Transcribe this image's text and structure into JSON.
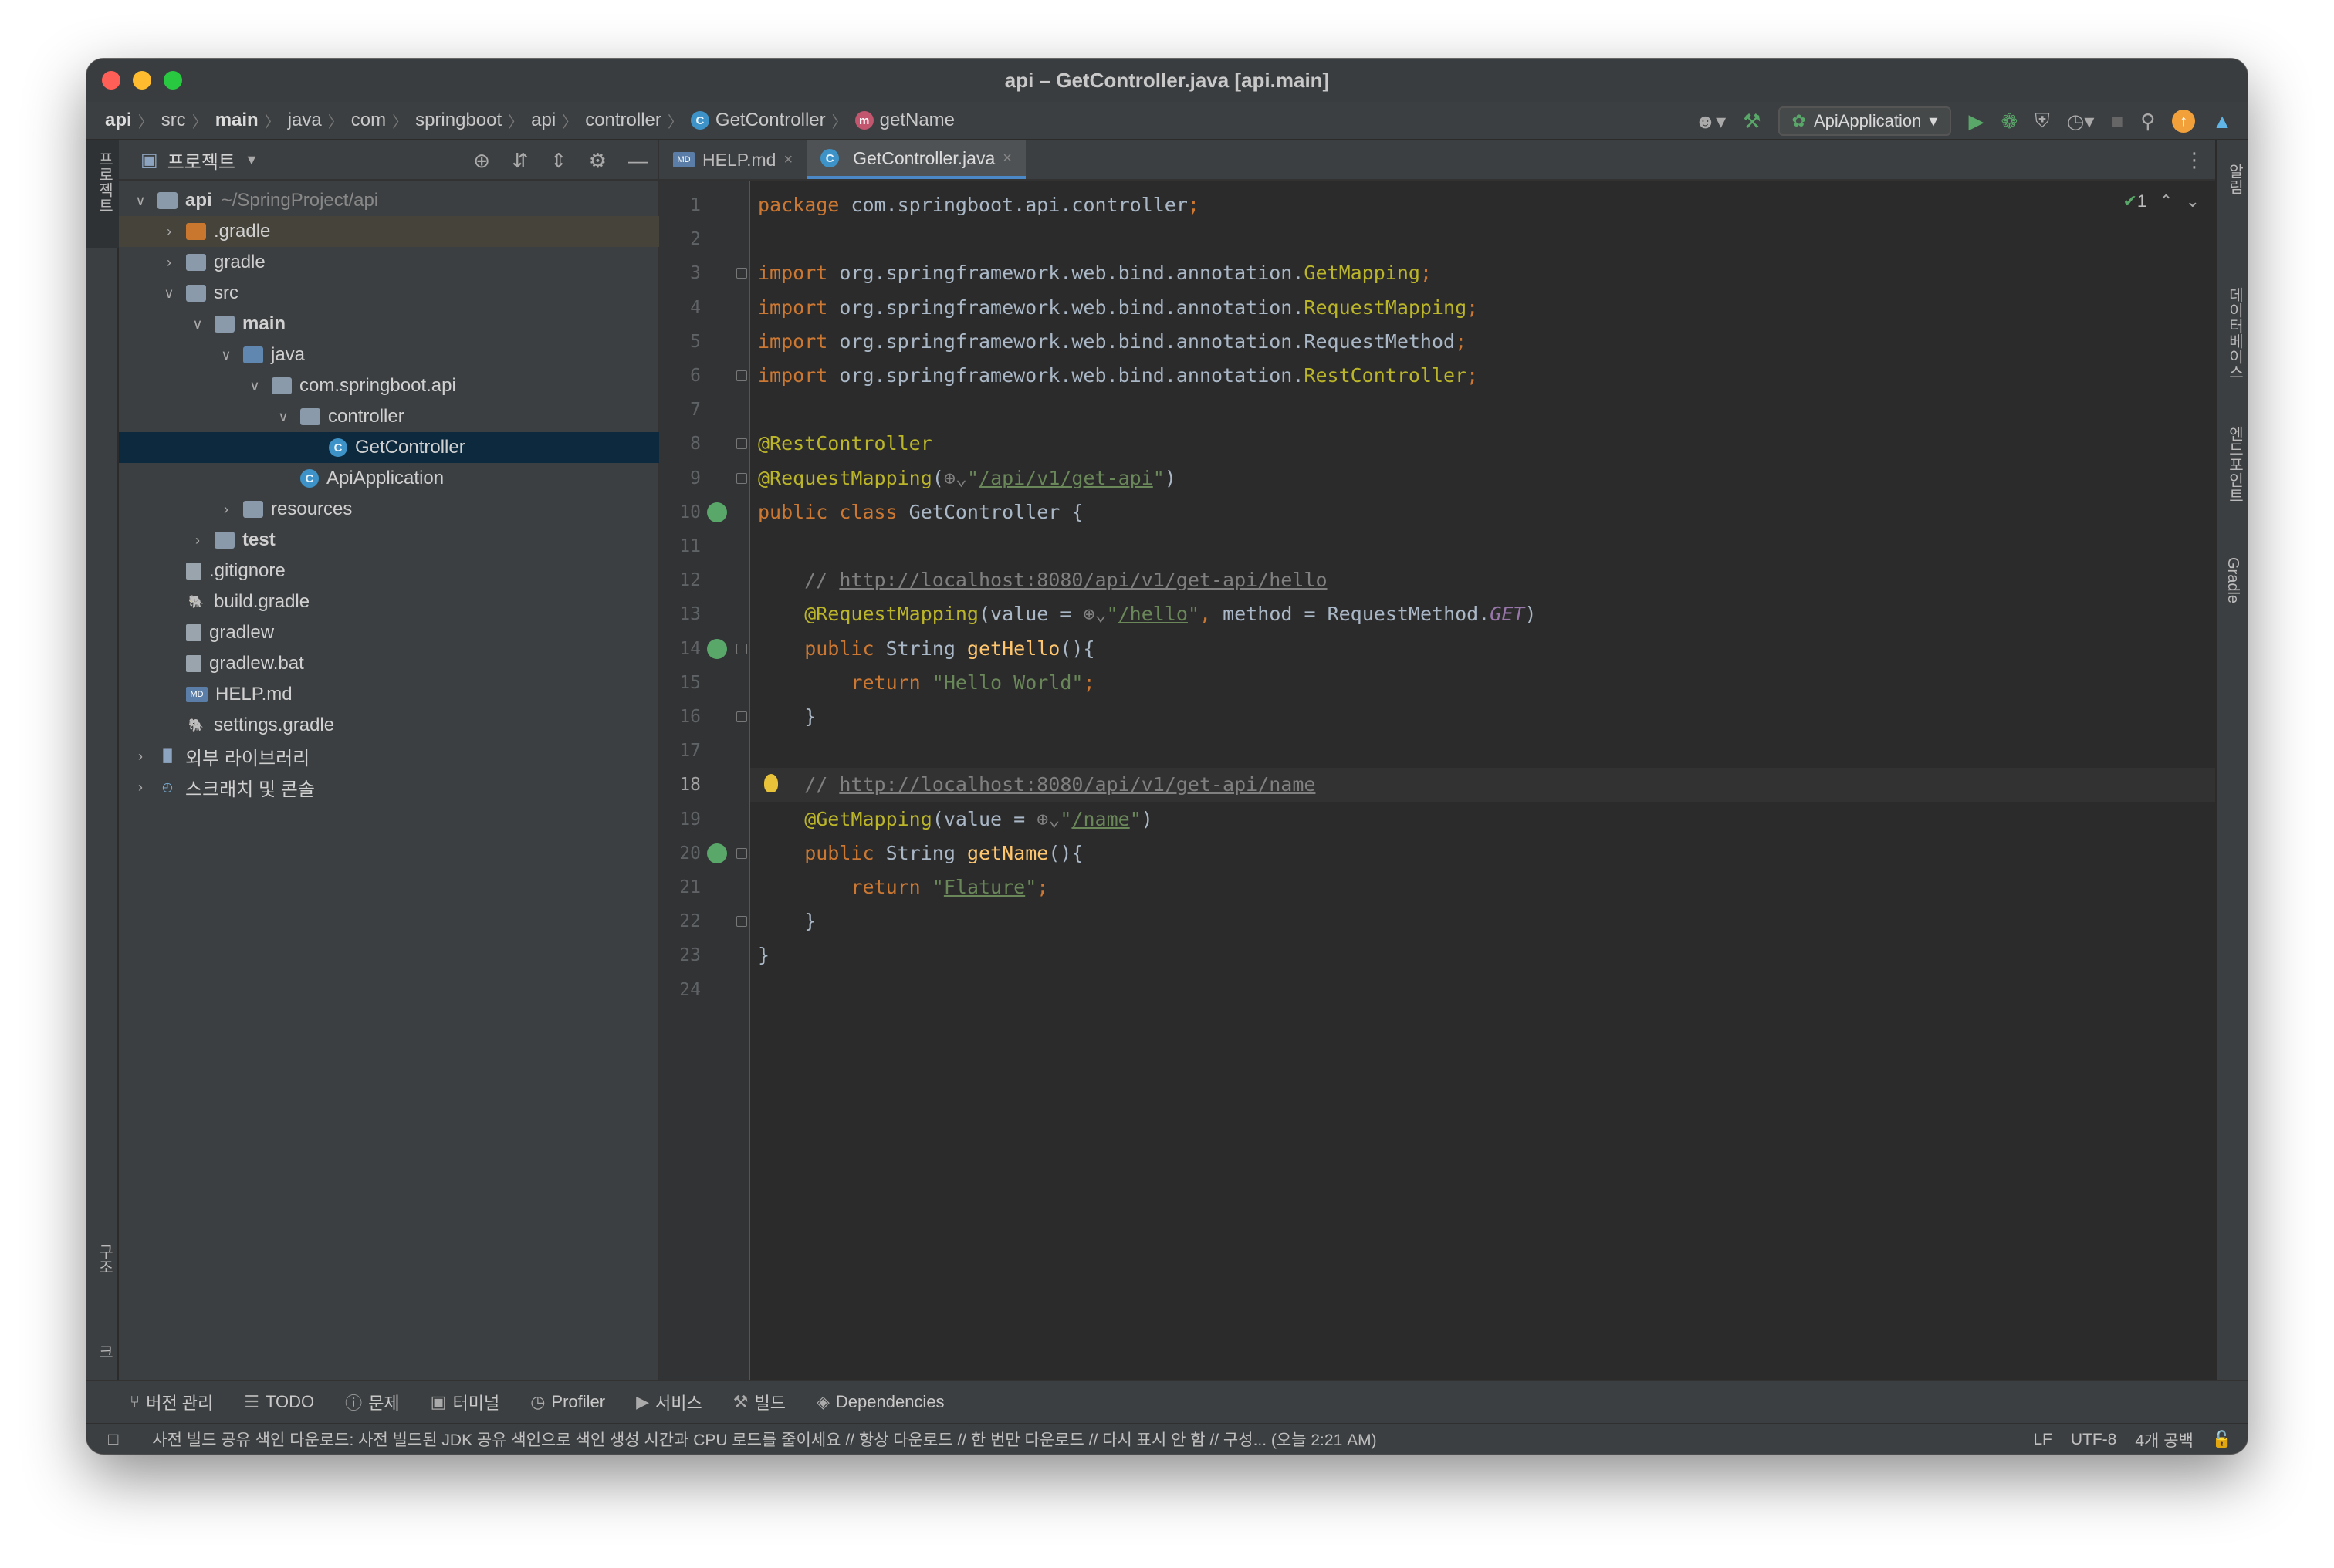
{
  "window": {
    "title": "api – GetController.java [api.main]"
  },
  "breadcrumbs": [
    {
      "label": "api",
      "bold": true
    },
    {
      "label": "src"
    },
    {
      "label": "main",
      "bold": true
    },
    {
      "label": "java"
    },
    {
      "label": "com"
    },
    {
      "label": "springboot"
    },
    {
      "label": "api"
    },
    {
      "label": "controller"
    },
    {
      "label": "GetController",
      "icon": "class-icon"
    },
    {
      "label": "getName",
      "icon": "method-icon"
    }
  ],
  "toolbar": {
    "run_config": "ApiApplication",
    "icons": [
      "user-icon",
      "build-hammer-icon",
      "run-icon",
      "debug-icon",
      "coverage-icon",
      "profile-icon",
      "stop-icon",
      "search-icon",
      "update-icon",
      "plugin-icon"
    ]
  },
  "left_strip": {
    "top_label": "프로젝트",
    "bottom_labels": [
      "구조",
      "북마크"
    ]
  },
  "right_strip": {
    "labels": [
      "알림",
      "데이터베이스",
      "엔드포인트",
      "Gradle"
    ]
  },
  "project_panel": {
    "title": "프로젝트",
    "tree": [
      {
        "label": "api",
        "hint": "~/SpringProject/api",
        "level": 0,
        "expanded": true,
        "icon": "module-folder",
        "bold": true
      },
      {
        "label": ".gradle",
        "level": 1,
        "expanded": false,
        "icon": "folder-orange"
      },
      {
        "label": "gradle",
        "level": 1,
        "expanded": false,
        "icon": "folder"
      },
      {
        "label": "src",
        "level": 1,
        "expanded": true,
        "icon": "folder"
      },
      {
        "label": "main",
        "level": 2,
        "expanded": true,
        "icon": "folder",
        "bold": true
      },
      {
        "label": "java",
        "level": 3,
        "expanded": true,
        "icon": "folder-blue"
      },
      {
        "label": "com.springboot.api",
        "level": 4,
        "expanded": true,
        "icon": "package"
      },
      {
        "label": "controller",
        "level": 5,
        "expanded": true,
        "icon": "package"
      },
      {
        "label": "GetController",
        "level": 6,
        "icon": "class",
        "selected": true
      },
      {
        "label": "ApiApplication",
        "level": 5,
        "icon": "spring-class"
      },
      {
        "label": "resources",
        "level": 3,
        "expanded": false,
        "icon": "folder"
      },
      {
        "label": "test",
        "level": 2,
        "expanded": false,
        "icon": "folder",
        "bold": true
      },
      {
        "label": ".gitignore",
        "level": 1,
        "icon": "file"
      },
      {
        "label": "build.gradle",
        "level": 1,
        "icon": "gradle"
      },
      {
        "label": "gradlew",
        "level": 1,
        "icon": "terminal-file"
      },
      {
        "label": "gradlew.bat",
        "level": 1,
        "icon": "file"
      },
      {
        "label": "HELP.md",
        "level": 1,
        "icon": "md-file"
      },
      {
        "label": "settings.gradle",
        "level": 1,
        "icon": "gradle"
      },
      {
        "label": "외부 라이브러리",
        "level": 0,
        "expanded": false,
        "icon": "library"
      },
      {
        "label": "스크래치 및 콘솔",
        "level": 0,
        "expanded": false,
        "icon": "scratch"
      }
    ]
  },
  "tabs": [
    {
      "label": "HELP.md",
      "active": false,
      "icon": "md-icon"
    },
    {
      "label": "GetController.java",
      "active": true,
      "icon": "class-icon"
    }
  ],
  "editor": {
    "current_line": 18,
    "inspection_count": "1",
    "lines": [
      {
        "n": "1",
        "tokens": [
          [
            "kw",
            "package "
          ],
          [
            "",
            "com.springboot.api.controller"
          ],
          [
            "kw",
            ";"
          ]
        ]
      },
      {
        "n": "2",
        "tokens": []
      },
      {
        "n": "3",
        "tokens": [
          [
            "kw",
            "import "
          ],
          [
            "",
            "org.springframework.web.bind.annotation."
          ],
          [
            "ann",
            "GetMapping"
          ],
          [
            "kw",
            ";"
          ]
        ],
        "fold": true
      },
      {
        "n": "4",
        "tokens": [
          [
            "kw",
            "import "
          ],
          [
            "",
            "org.springframework.web.bind.annotation."
          ],
          [
            "ann",
            "RequestMapping"
          ],
          [
            "kw",
            ";"
          ]
        ]
      },
      {
        "n": "5",
        "tokens": [
          [
            "kw",
            "import "
          ],
          [
            "",
            "org.springframework.web.bind.annotation.RequestMethod"
          ],
          [
            "kw",
            ";"
          ]
        ]
      },
      {
        "n": "6",
        "tokens": [
          [
            "kw",
            "import "
          ],
          [
            "",
            "org.springframework.web.bind.annotation."
          ],
          [
            "ann",
            "RestController"
          ],
          [
            "kw",
            ";"
          ]
        ],
        "fold": true
      },
      {
        "n": "7",
        "tokens": []
      },
      {
        "n": "8",
        "tokens": [
          [
            "ann",
            "@RestController"
          ]
        ],
        "fold": true
      },
      {
        "n": "9",
        "tokens": [
          [
            "ann",
            "@RequestMapping"
          ],
          [
            "",
            "("
          ],
          [
            "cm",
            "⊕⌄"
          ],
          [
            "str",
            "\""
          ],
          [
            "strlink",
            "/api/v1/get-api"
          ],
          [
            "str",
            "\""
          ],
          [
            "",
            ")"
          ]
        ],
        "fold": true
      },
      {
        "n": "10",
        "tokens": [
          [
            "kw",
            "public class "
          ],
          [
            "",
            "GetController {"
          ]
        ],
        "gutter": "spring-bean-icon"
      },
      {
        "n": "11",
        "tokens": []
      },
      {
        "n": "12",
        "tokens": [
          [
            "cm",
            "    // "
          ],
          [
            "link",
            "http://localhost:8080/api/v1/get-api/hello"
          ]
        ]
      },
      {
        "n": "13",
        "tokens": [
          [
            "ann",
            "    @RequestMapping"
          ],
          [
            "",
            "(value = "
          ],
          [
            "cm",
            "⊕⌄"
          ],
          [
            "str",
            "\""
          ],
          [
            "strlink",
            "/hello"
          ],
          [
            "str",
            "\""
          ],
          [
            "kw",
            ", "
          ],
          [
            "",
            "method = RequestMethod."
          ],
          [
            "const",
            "GET"
          ],
          [
            "",
            ")"
          ]
        ]
      },
      {
        "n": "14",
        "tokens": [
          [
            "kw",
            "    public "
          ],
          [
            "",
            "String "
          ],
          [
            "fn",
            "getHello"
          ],
          [
            "",
            "(){"
          ]
        ],
        "gutter": "endpoint-icon",
        "fold": true
      },
      {
        "n": "15",
        "tokens": [
          [
            "kw",
            "        return "
          ],
          [
            "str",
            "\"Hello World\""
          ],
          [
            "kw",
            ";"
          ]
        ]
      },
      {
        "n": "16",
        "tokens": [
          [
            "",
            "    }"
          ]
        ],
        "fold": true
      },
      {
        "n": "17",
        "tokens": []
      },
      {
        "n": "18",
        "tokens": [
          [
            "cm",
            "    // "
          ],
          [
            "link",
            "http://localhost:8080/api/v1/get-api/name"
          ]
        ],
        "bulb": true
      },
      {
        "n": "19",
        "tokens": [
          [
            "ann",
            "    @GetMapping"
          ],
          [
            "",
            "(value = "
          ],
          [
            "cm",
            "⊕⌄"
          ],
          [
            "str",
            "\""
          ],
          [
            "strlink",
            "/name"
          ],
          [
            "str",
            "\""
          ],
          [
            "",
            ")"
          ]
        ]
      },
      {
        "n": "20",
        "tokens": [
          [
            "kw",
            "    public "
          ],
          [
            "",
            "String "
          ],
          [
            "fn",
            "getName"
          ],
          [
            "",
            "(){"
          ]
        ],
        "gutter": "endpoint-icon",
        "fold": true
      },
      {
        "n": "21",
        "tokens": [
          [
            "kw",
            "        return "
          ],
          [
            "str",
            "\""
          ],
          [
            "strlink",
            "Flature"
          ],
          [
            "str",
            "\""
          ],
          [
            "kw",
            ";"
          ]
        ]
      },
      {
        "n": "22",
        "tokens": [
          [
            "",
            "    }"
          ]
        ],
        "fold": true
      },
      {
        "n": "23",
        "tokens": [
          [
            "",
            "}"
          ]
        ]
      },
      {
        "n": "24",
        "tokens": []
      }
    ]
  },
  "bottom_tools": [
    {
      "label": "버전 관리",
      "icon": "vcs-icon"
    },
    {
      "label": "TODO",
      "icon": "todo-icon"
    },
    {
      "label": "문제",
      "icon": "problems-icon"
    },
    {
      "label": "터미널",
      "icon": "terminal-icon"
    },
    {
      "label": "Profiler",
      "icon": "profiler-icon"
    },
    {
      "label": "서비스",
      "icon": "services-icon"
    },
    {
      "label": "빌드",
      "icon": "build-icon"
    },
    {
      "label": "Dependencies",
      "icon": "dependencies-icon"
    }
  ],
  "status": {
    "message": "사전 빌드 공유 색인 다운로드: 사전 빌드된 JDK 공유 색인으로 색인 생성 시간과 CPU 로드를 줄이세요 // 항상 다운로드 // 한 번만 다운로드 // 다시 표시 안 함 // 구성... (오늘 2:21 AM)",
    "line_sep": "LF",
    "encoding": "UTF-8",
    "indent": "4개 공백"
  }
}
